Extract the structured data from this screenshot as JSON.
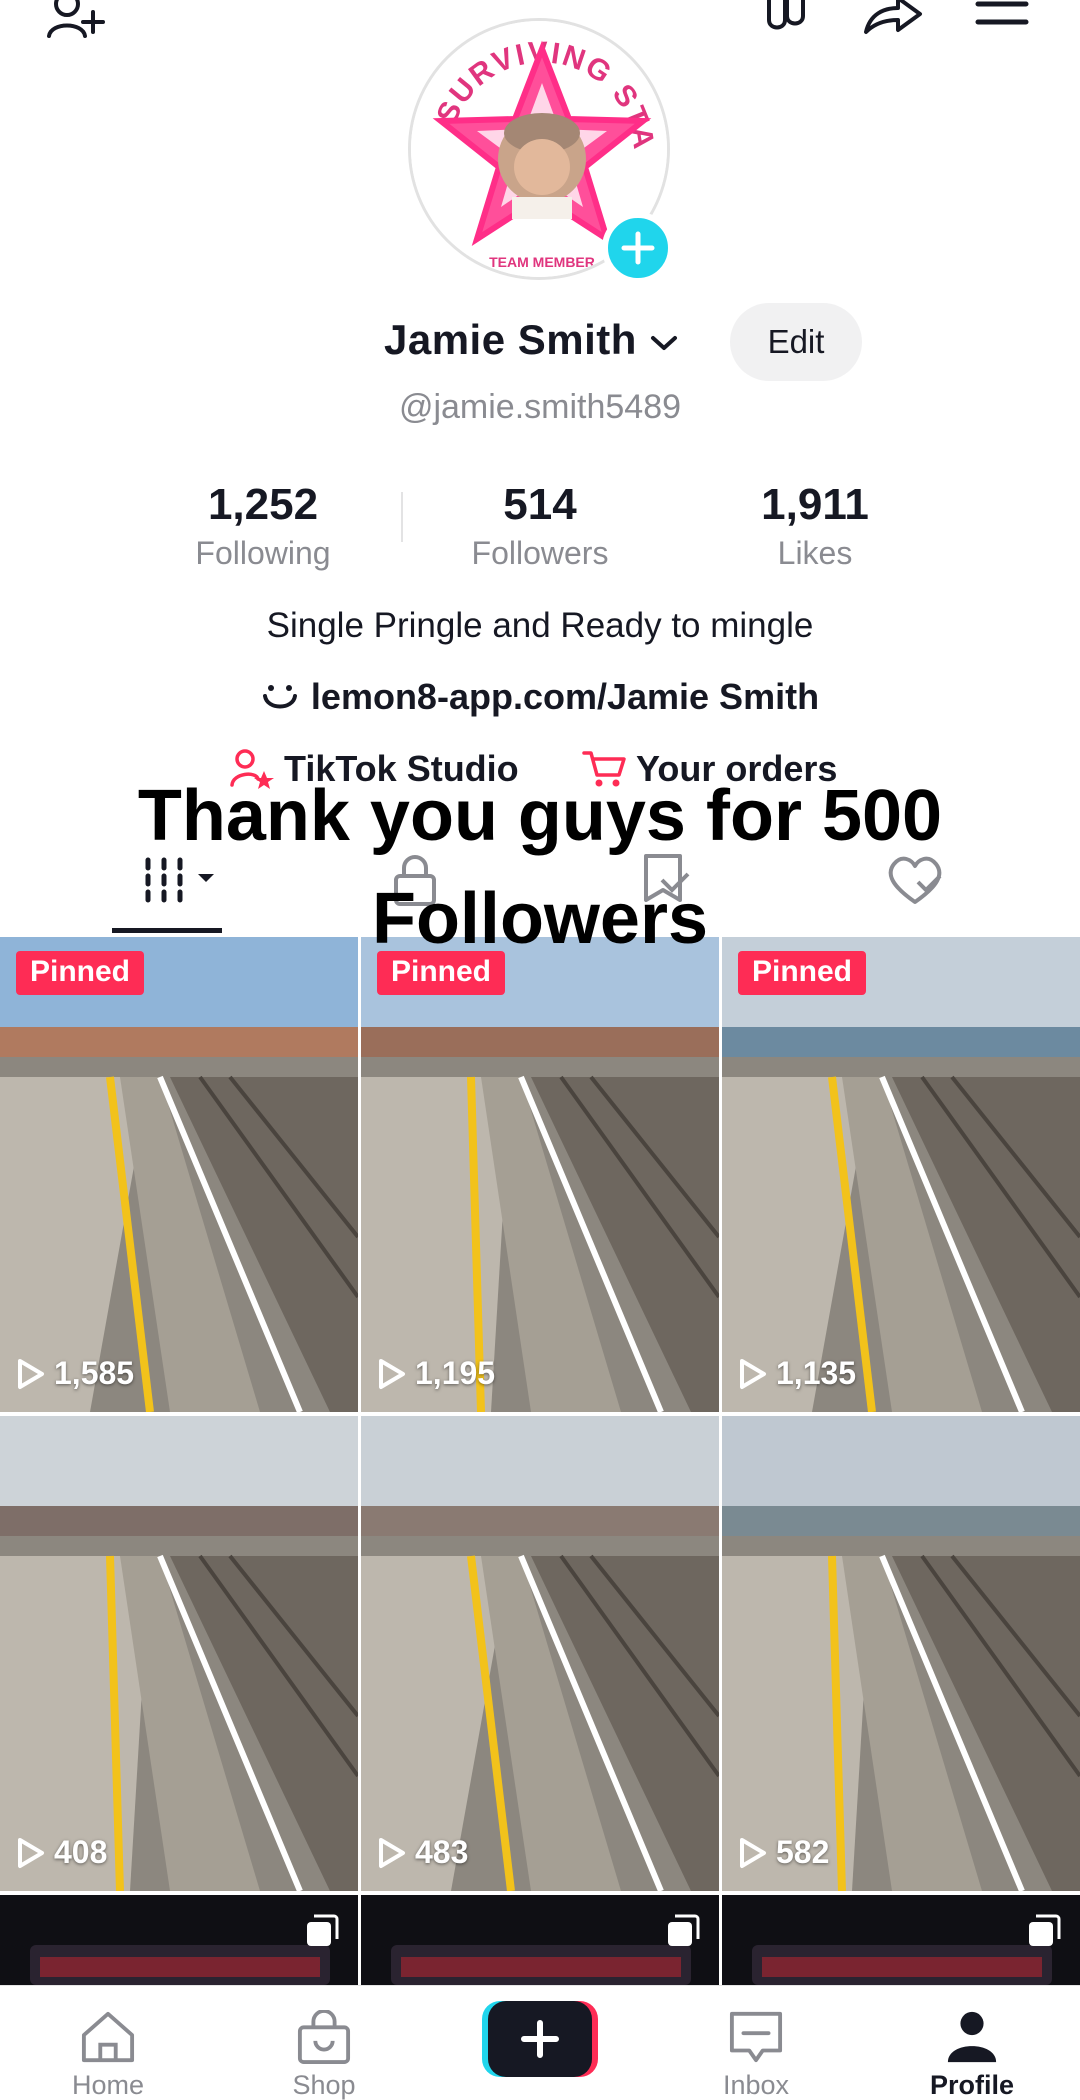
{
  "top_icons": [
    "add-friend-icon",
    "footprints-icon",
    "share-icon",
    "menu-icon"
  ],
  "profile": {
    "avatar_badge_text": "SURVIVING STARS TEAM MEMBER",
    "name": "Jamie Smith",
    "edit_label": "Edit",
    "handle": "@jamie.smith5489",
    "stats": [
      {
        "value": "1,252",
        "label": "Following"
      },
      {
        "value": "514",
        "label": "Followers"
      },
      {
        "value": "1,911",
        "label": "Likes"
      }
    ],
    "bio": "Single Pringle and Ready to mingle",
    "link": "lemon8-app.com/Jamie Smith",
    "shortcuts": [
      {
        "label": "TikTok Studio",
        "icon": "person-star-icon"
      },
      {
        "label": "Your orders",
        "icon": "cart-icon"
      }
    ]
  },
  "overlay_caption": {
    "line1": "Thank you guys for 500",
    "line2": "Followers"
  },
  "tabs": [
    "videos-grid-icon",
    "lock-icon",
    "saved-tag-icon",
    "liked-heart-icon"
  ],
  "videos": [
    {
      "pinned": "Pinned",
      "views": "1,585"
    },
    {
      "pinned": "Pinned",
      "views": "1,195"
    },
    {
      "pinned": "Pinned",
      "views": "1,135"
    },
    {
      "pinned": "",
      "views": "408"
    },
    {
      "pinned": "",
      "views": "483"
    },
    {
      "pinned": "",
      "views": "582"
    }
  ],
  "bottom_nav": [
    {
      "label": "Home",
      "icon": "home-icon"
    },
    {
      "label": "Shop",
      "icon": "shopping-bag-icon"
    },
    {
      "label": "",
      "icon": "plus-icon"
    },
    {
      "label": "Inbox",
      "icon": "inbox-icon"
    },
    {
      "label": "Profile",
      "icon": "profile-icon"
    }
  ],
  "colors": {
    "accent_red": "#fe2c55",
    "accent_cyan": "#20d5ec",
    "text": "#161823",
    "muted": "#8a8b91"
  }
}
